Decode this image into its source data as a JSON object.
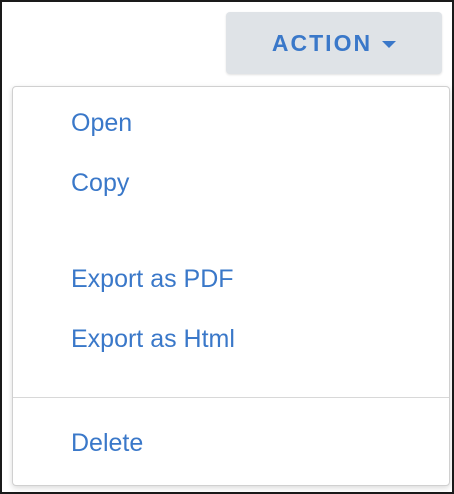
{
  "action_button": {
    "label": "ACTION",
    "caret_icon": "caret-down-icon"
  },
  "menu": {
    "items": [
      {
        "label": "Open"
      },
      {
        "label": "Copy"
      },
      {
        "label": "Export as PDF"
      },
      {
        "label": "Export as Html"
      },
      {
        "label": "Delete"
      }
    ]
  },
  "colors": {
    "accent": "#3a78c9",
    "button_bg": "#dfe3e7",
    "divider": "#d8d8d8"
  }
}
